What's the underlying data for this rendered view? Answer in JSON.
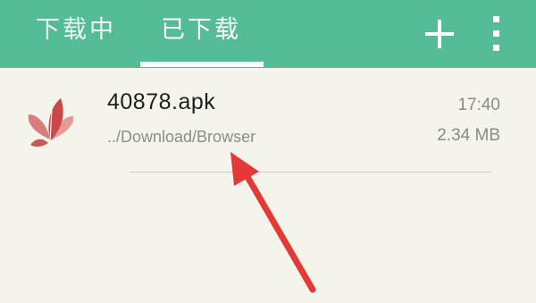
{
  "tabs": [
    {
      "label": "下载中"
    },
    {
      "label": "已下载"
    }
  ],
  "header": {
    "add_icon": "plus-icon",
    "more_icon": "more-vertical-icon",
    "accent_color": "#55bd96"
  },
  "downloads": [
    {
      "name": "40878.apk",
      "path": "../Download/Browser",
      "time": "17:40",
      "size": "2.34 MB",
      "icon": "butterfly-app-icon"
    }
  ],
  "annotation": {
    "color": "#e53935",
    "icon": "red-arrow-icon"
  }
}
